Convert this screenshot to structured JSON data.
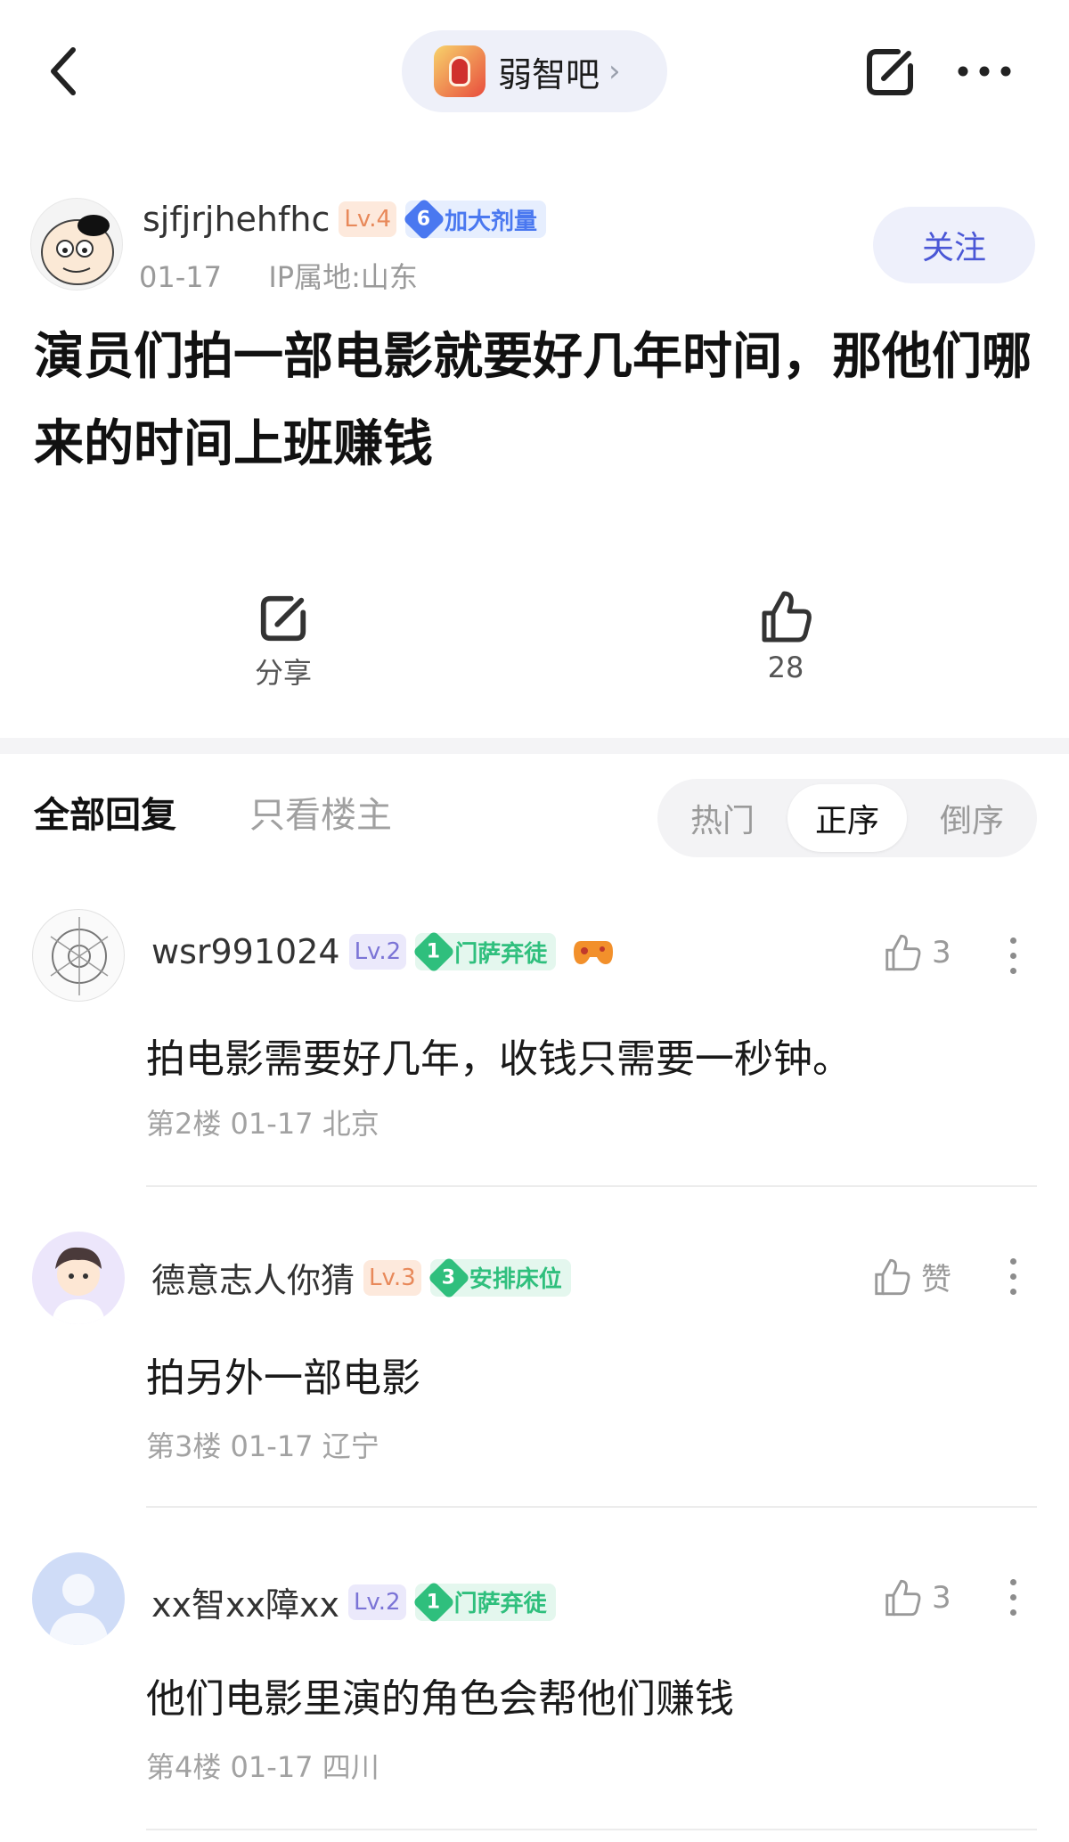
{
  "header": {
    "forum_name": "弱智吧",
    "forum_chevron": "›",
    "back_icon": "chevron-left-icon",
    "share_icon": "share-icon",
    "more_icon": "more-dots-icon"
  },
  "post": {
    "author": "sjfjrjhehfhc",
    "level": "Lv.4",
    "badge_num": "6",
    "badge_text": "加大剂量",
    "date": "01-17",
    "ip": "IP属地:山东",
    "follow_label": "关注",
    "title": "演员们拍一部电影就要好几年时间，那他们哪来的时间上班赚钱",
    "share_label": "分享",
    "like_count": "28"
  },
  "tabs": {
    "all_replies": "全部回复",
    "op_only": "只看楼主",
    "sort": [
      "热门",
      "正序",
      "倒序"
    ],
    "active_sort": "正序"
  },
  "comments": [
    {
      "user": "wsr991024",
      "level": "Lv.2",
      "badge_num": "1",
      "badge_text": "门萨弃徒",
      "likes": "3",
      "text": "拍电影需要好几年，收钱只需要一秒钟。",
      "floor": "第2楼",
      "date": "01-17",
      "location": "北京"
    },
    {
      "user": "德意志人你猜",
      "level": "Lv.3",
      "badge_num": "3",
      "badge_text": "安排床位",
      "likes": "赞",
      "text": "拍另外一部电影",
      "floor": "第3楼",
      "date": "01-17",
      "location": "辽宁"
    },
    {
      "user": "xx智xx障xx",
      "level": "Lv.2",
      "badge_num": "1",
      "badge_text": "门萨弃徒",
      "likes": "3",
      "text": "他们电影里演的角色会帮他们赚钱",
      "floor": "第4楼",
      "date": "01-17",
      "location": "四川"
    }
  ],
  "colors": {
    "accent": "#4a57d6",
    "level_orange_bg": "#fde9dc",
    "level_orange_text": "#e8895a",
    "level_purple_bg": "#ebe9fb",
    "level_purple_text": "#7b74d6",
    "badge_blue": "#4a78f0",
    "badge_green": "#2fbf7d"
  }
}
